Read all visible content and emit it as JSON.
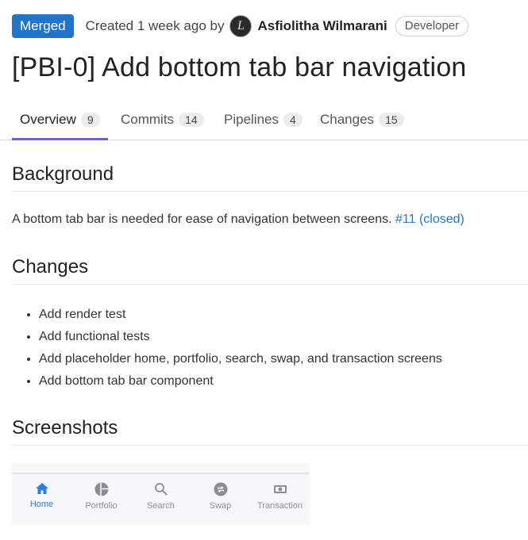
{
  "header": {
    "status": "Merged",
    "created_text": "Created 1 week ago by",
    "avatar_glyph": "L",
    "author": "Asfiolitha Wilmarani",
    "role": "Developer",
    "title": "[PBI-0] Add bottom tab bar navigation"
  },
  "tabs": [
    {
      "label": "Overview",
      "count": "9"
    },
    {
      "label": "Commits",
      "count": "14"
    },
    {
      "label": "Pipelines",
      "count": "4"
    },
    {
      "label": "Changes",
      "count": "15"
    }
  ],
  "sections": {
    "background": {
      "heading": "Background",
      "text": "A bottom tab bar is needed for ease of navigation between screens.",
      "link": "#11 (closed)"
    },
    "changes": {
      "heading": "Changes",
      "items": [
        "Add render test",
        "Add functional tests",
        "Add placeholder home, portfolio, search, swap, and transaction screens",
        "Add bottom tab bar component"
      ]
    },
    "screenshots": {
      "heading": "Screenshots",
      "tabbar": [
        {
          "label": "Home",
          "icon": "home-icon"
        },
        {
          "label": "Portfolio",
          "icon": "pie-chart-icon"
        },
        {
          "label": "Search",
          "icon": "search-icon"
        },
        {
          "label": "Swap",
          "icon": "swap-icon"
        },
        {
          "label": "Transaction",
          "icon": "cash-icon"
        }
      ]
    }
  }
}
